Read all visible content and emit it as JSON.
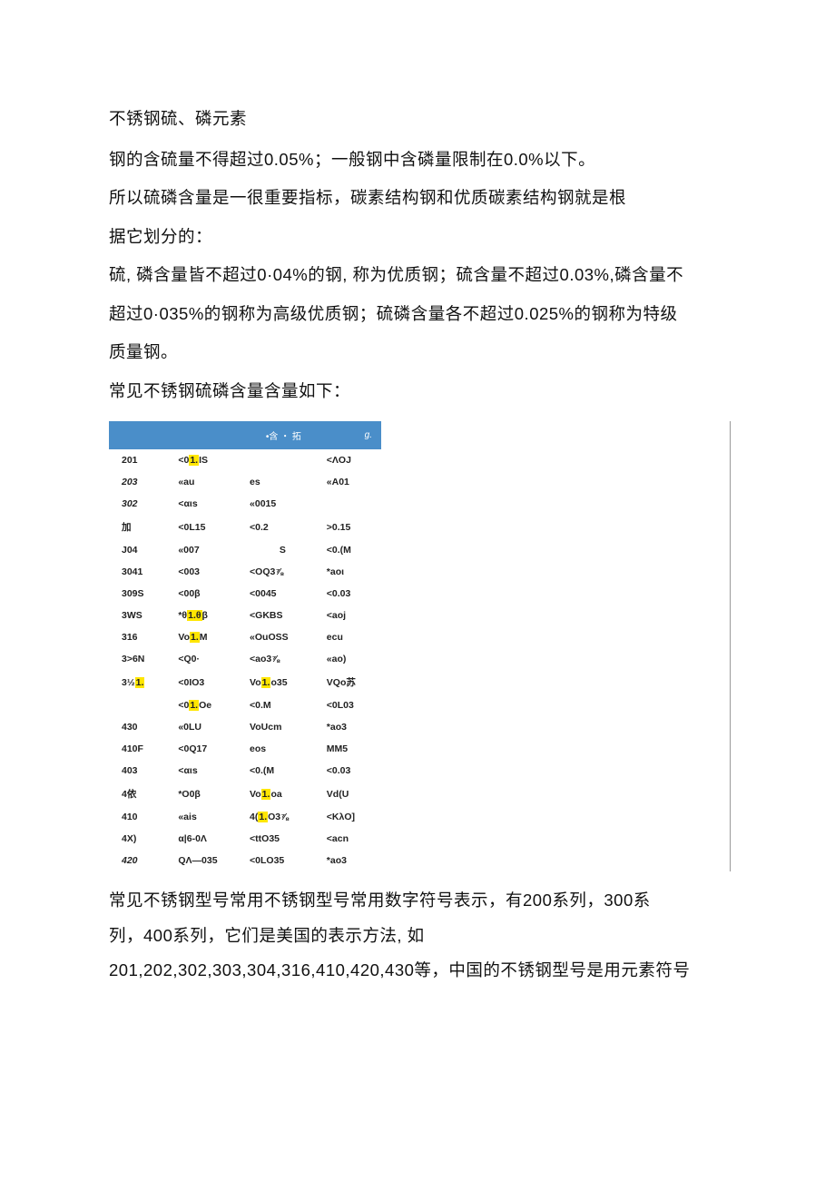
{
  "intro": {
    "title": "不锈钢硫、磷元素",
    "p1": "钢的含硫量不得超过0.05%；一般钢中含磷量限制在0.0%以下。",
    "p2": "所以硫磷含量是一很重要指标，碳素结构钢和优质碳素结构钢就是根",
    "p3": "据它划分的：",
    "p4": "硫, 磷含量皆不超过0·04%的钢, 称为优质钢；硫含量不超过0.03%,磷含量不",
    "p5": "超过0·035%的钢称为高级优质钢；硫磷含量各不超过0.025%的钢称为特级",
    "p6": "质量钢。",
    "p7": "常见不锈钢硫磷含量含量如下："
  },
  "table": {
    "head": {
      "c1": "",
      "c2": "",
      "c3": "•含 ・ 拓",
      "c4": "g."
    }
  },
  "chart_data": {
    "type": "table",
    "columns": [
      "grade",
      "col2",
      "col3",
      "col4"
    ],
    "rows": [
      {
        "grade": "201",
        "c2a": "<0",
        "c2hl": "1.",
        "c2b": "IS",
        "c3": "",
        "c4": "<ΛOJ",
        "it": false
      },
      {
        "grade": "203",
        "c2a": "«au",
        "c2hl": "",
        "c2b": "",
        "c3": "es",
        "c4": "«A01",
        "it": true
      },
      {
        "grade": "302",
        "c2a": "<αιs",
        "c2hl": "",
        "c2b": "",
        "c3": "«0015",
        "c4": "",
        "it": true
      },
      {
        "grade": "加",
        "c2a": "<0L15",
        "c2hl": "",
        "c2b": "",
        "c3": "<0.2",
        "c4": ">0.15",
        "it": false
      },
      {
        "grade": "J04",
        "c2a": "«007",
        "c2hl": "",
        "c2b": "",
        "c3": "S",
        "c4": "<0.(M",
        "it": false,
        "c3center": true
      },
      {
        "grade": "3041",
        "c2a": "<003",
        "c2hl": "",
        "c2b": "",
        "c3": "<OQ3⅞",
        "c4": "*aoι",
        "it": false
      },
      {
        "grade": "309S",
        "c2a": "<00β",
        "c2hl": "",
        "c2b": "",
        "c3": "<0045",
        "c4": "<0.03",
        "it": false
      },
      {
        "grade": "3WS",
        "c2a": "*θ",
        "c2hl": "1.θ",
        "c2b": "β",
        "c3": "<GKBS",
        "c4": "<aoj",
        "it": false
      },
      {
        "grade": "316",
        "c2a": "Vo",
        "c2hl": "1.",
        "c2b": "M",
        "c3": "«OuOSS",
        "c4": "ecu",
        "it": false
      },
      {
        "grade": "3>6N",
        "c2a": "<Q0·",
        "c2hl": "",
        "c2b": "",
        "c3": "<ao3⅞",
        "c4": "«ao)",
        "it": false
      },
      {
        "grade": "3½",
        "c1hl": "1.",
        "c2a": "<0IO3",
        "c2hl": "",
        "c2b": "",
        "c3a": "Vo",
        "c3hl": "1.",
        "c3b": "o35",
        "c4": "VQo苏",
        "it": false
      },
      {
        "grade": "",
        "c2a": "<0",
        "c2hl": "1.",
        "c2b": "Oe",
        "c3": "<0.M",
        "c4": "<0L03",
        "it": false
      },
      {
        "grade": "430",
        "c2a": "«0LU",
        "c2hl": "",
        "c2b": "",
        "c3": "VoUcm",
        "c4": "*ao3",
        "it": false
      },
      {
        "grade": "410F",
        "c2a": "<0Q17",
        "c2hl": "",
        "c2b": "",
        "c3": "eos",
        "c4": "MM5",
        "it": false
      },
      {
        "grade": "403",
        "c2a": "<αιs",
        "c2hl": "",
        "c2b": "",
        "c3": "<0.(M",
        "c4": "<0.03",
        "it": false
      },
      {
        "grade": "4依",
        "c2a": "*O0β",
        "c2hl": "",
        "c2b": "",
        "c3a": "Vo",
        "c3hl": "1.",
        "c3b": "oa",
        "c4": "Vd(U",
        "it": false
      },
      {
        "grade": "410",
        "c2a": "«ais",
        "c2hl": "",
        "c2b": "",
        "c3a": "4(",
        "c3hl": "1.",
        "c3b": "O3⅞",
        "c4": "<KλO]",
        "it": false
      },
      {
        "grade": "4X)",
        "c2a": "α|6-0Λ",
        "c2hl": "",
        "c2b": "",
        "c3": "<ttO35",
        "c4": "<acn",
        "it": false
      },
      {
        "grade": "420",
        "c2a": "QΛ—035",
        "c2hl": "",
        "c2b": "",
        "c3": "<0LO35",
        "c4": "*ao3",
        "it": true
      }
    ]
  },
  "footer": {
    "p1": "常见不锈钢型号常用不锈钢型号常用数字符号表示，有200系列，300系",
    "p2": "列，400系列，它们是美国的表示方法, 如",
    "p3": "201,202,302,303,304,316,410,420,430等，中国的不锈钢型号是用元素符号"
  }
}
